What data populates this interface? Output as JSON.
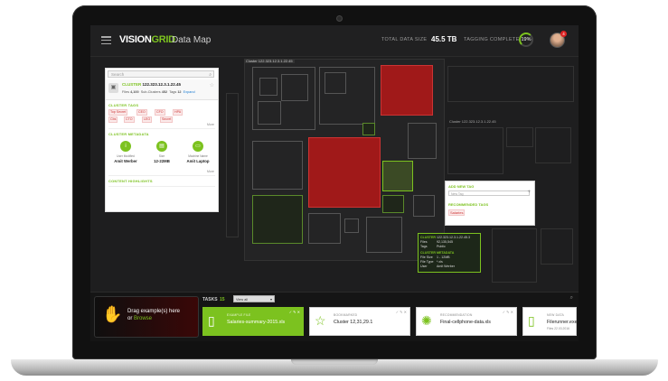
{
  "header": {
    "logo_vision": "VISION",
    "logo_grid": "GRID",
    "title": "Data Map",
    "total_label": "TOTAL DATA SIZE",
    "total_value": "45.5 TB",
    "tagging_label": "TAGGING COMPLETE",
    "tagging_value": "19%",
    "notification_count": "4"
  },
  "left_panel": {
    "search_placeholder": "Search",
    "cluster_label": "CLUSTER",
    "cluster_id": "122.323.12.3.1.22.45",
    "files_label": "Files",
    "files_value": "4,100",
    "subclusters_label": "Sub-Clusters",
    "subclusters_value": "452",
    "tags_label": "Tags",
    "tags_value": "12",
    "expand_label": "Expand",
    "cluster_tags_title": "CLUSTER TAGS",
    "tags": [
      "Top Secret",
      "CEO",
      "CFO",
      "HPA",
      "Cbs",
      "CTO",
      "LEO",
      "Secret"
    ],
    "more_label": "More",
    "metadata_title": "CLUSTER METADATA",
    "metadata": [
      {
        "label": "User Modified",
        "value": "Amit Werber",
        "icon": "user-icon"
      },
      {
        "label": "Size",
        "value": "12-22MB",
        "icon": "file-icon"
      },
      {
        "label": "Machine Name",
        "value": "Amit Laptop",
        "icon": "laptop-icon"
      }
    ],
    "highlights_title": "CONTENT HIGHLIGHTS"
  },
  "map": {
    "cluster_top_label": "Cluster 122.323.12.3.1.22.45",
    "cluster_right_label": "Cluster 122.323.12.3.1.22.45"
  },
  "tag_popup": {
    "add_title": "ADD NEW TAG",
    "input_placeholder": "New Tag",
    "recommended_title": "RECOMMENDED TAGS",
    "recommended_tag": "Salaries"
  },
  "tooltip": {
    "cluster_label": "CLUSTER",
    "cluster_id": "122.323.12.3.1.22.45.3",
    "files_label": "Files",
    "files_value": "92,135,545",
    "tags_label": "Tags",
    "tags_value": "Public",
    "meta_title": "CLUSTER METADATA",
    "size_label": "File Size",
    "size_value": "1 - 12MB",
    "type_label": "File Type",
    "type_value": "*.xls",
    "user_label": "User",
    "user_value": "Amit Werber"
  },
  "bottom": {
    "drop_text": "Drag example(s) here",
    "drop_or": "or",
    "drop_browse": "Browse",
    "tasks_label": "TASKS",
    "tasks_count": "15",
    "view_select": "View all",
    "cards": [
      {
        "label": "EXAMPLE FILE",
        "value": "Salaries-summary-2015.xls",
        "sub": "",
        "icon": "file-icon"
      },
      {
        "label": "BOOKMARKED",
        "value": "Cluster 12,31,29.1",
        "sub": "",
        "icon": "star-icon"
      },
      {
        "label": "RECOMMENDATION",
        "value": "Final-cellphone-data.xls",
        "sub": "",
        "icon": "lightbulb-icon"
      },
      {
        "label": "NEW DATA",
        "value": "Filerunner.exe",
        "sub": "Files 22.03.2016",
        "icon": "file-icon"
      }
    ]
  },
  "colors": {
    "accent": "#7cc21f",
    "alert": "#a01919",
    "background": "#1c1c1d"
  }
}
